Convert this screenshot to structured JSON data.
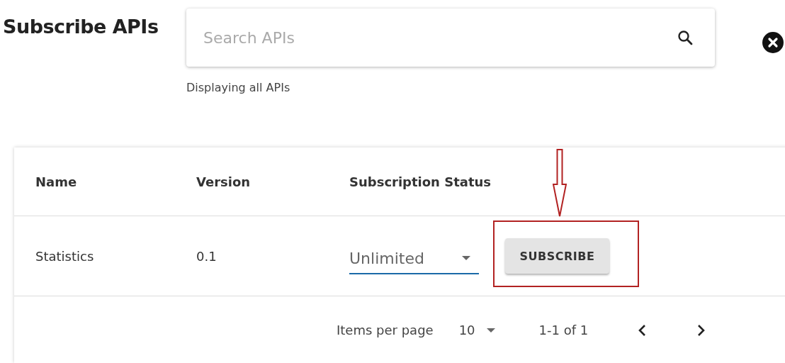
{
  "title": "Subscribe APIs",
  "search": {
    "placeholder": "Search APIs"
  },
  "result_note": "Displaying all APIs",
  "table": {
    "columns": [
      "Name",
      "Version",
      "Subscription Status"
    ],
    "rows": [
      {
        "name": "Statistics",
        "version": "0.1",
        "tier": "Unlimited",
        "action": "SUBSCRIBE",
        "highlighted": true
      }
    ]
  },
  "pagination": {
    "items_label": "Items per page",
    "page_size": "10",
    "range": "1-1 of 1"
  }
}
